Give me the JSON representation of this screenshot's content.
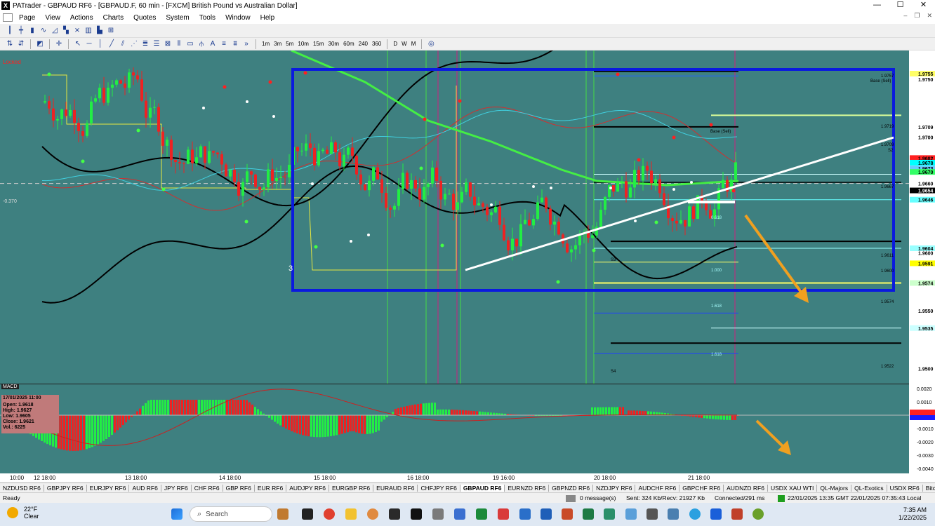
{
  "window": {
    "title": "PATrader - GBPAUD RF6 - [GBPAUD.F, 60 min - [FXCM] British Pound vs Australian Dollar]",
    "app_icon": "X"
  },
  "menu": [
    "Page",
    "View",
    "Actions",
    "Charts",
    "Quotes",
    "System",
    "Tools",
    "Window",
    "Help"
  ],
  "timeframes": [
    "1m",
    "3m",
    "5m",
    "10m",
    "15m",
    "30m",
    "60m",
    "240",
    "360",
    "D",
    "W",
    "M"
  ],
  "chart": {
    "locked_label": "Locked",
    "neg_label": "-0.370",
    "index_label": "INDEX",
    "box_label": "3",
    "price_axis": [
      {
        "price": "1.9755",
        "bg": "#ffff66"
      },
      {
        "price": "1.9750",
        "bg": null
      },
      {
        "price": "1.9709",
        "bg": "#ffffff"
      },
      {
        "price": "1.9700",
        "bg": null
      },
      {
        "price": "1.9682",
        "bg": "#ff2020"
      },
      {
        "price": "1.9678",
        "bg": "#00ffff"
      },
      {
        "price": "1.9673",
        "bg": "#66ccff"
      },
      {
        "price": "1.9670",
        "bg": "#33ff66"
      },
      {
        "price": "1.9660",
        "bg": "#ffffff"
      },
      {
        "price": "1.9654",
        "bg": "#000000"
      },
      {
        "price": "1.9646",
        "bg": "#66ffff"
      },
      {
        "price": "1.9604",
        "bg": "#99ffff"
      },
      {
        "price": "1.9600",
        "bg": null
      },
      {
        "price": "1.9591",
        "bg": "#ffff00"
      },
      {
        "price": "1.9574",
        "bg": "#ccffcc"
      },
      {
        "price": "1.9550",
        "bg": null
      },
      {
        "price": "1.9535",
        "bg": "#ccffff"
      },
      {
        "price": "1.9500",
        "bg": null
      }
    ],
    "level_labels": [
      "1.9757",
      "Base (Sell)",
      "1.9719",
      "Base (Sell)",
      "1.9709",
      "1.9667",
      "1.9611",
      "1.9600",
      "1.9574",
      "1.9522",
      "0.618",
      "1.000",
      "1.618",
      "1.618",
      "S4",
      "S3",
      "S2"
    ],
    "macd_axis": [
      "0.0020",
      "0.0010",
      "0.0000",
      "-0.0010",
      "-0.0020",
      "-0.0030",
      "-0.0040"
    ],
    "macd_label": "MACD",
    "time_axis": [
      "10:00",
      "12 18:00",
      "13 18:00",
      "14 18:00",
      "15 18:00",
      "16 18:00",
      "19 16:00",
      "20 18:00",
      "21 18:00"
    ]
  },
  "info_box": {
    "date": "17/01/2025 11:00",
    "open": "Open: 1.9618",
    "high": "High: 1.9627",
    "low": "Low: 1.9605",
    "close": "Close: 1.9621",
    "vol": "Vol.: 6225"
  },
  "tabs": [
    "NZDUSD RF6",
    "GBPJPY RF6",
    "EURJPY RF6",
    "AUD RF6",
    "JPY RF6",
    "CHF RF6",
    "GBP RF6",
    "EUR RF6",
    "AUDJPY RF6",
    "EURGBP RF6",
    "EURAUD RF6",
    "CHFJPY RF6",
    "GBPAUD RF6",
    "EURNZD RF6",
    "GBPNZD RF6",
    "NZDJPY RF6",
    "AUDCHF RF6",
    "GBPCHF RF6",
    "AUDNZD RF6",
    "USDX XAU WTI",
    "QL-Majors",
    "QL-Exotics",
    "USDX RF6",
    "Bitcoin",
    "SP500 RF6",
    "DJIA"
  ],
  "active_tab": "GBPAUD RF6",
  "status": {
    "ready": "Ready",
    "messages": "0 message(s)",
    "sent": "Sent: 324 Kb/Recv: 21927 Kb",
    "connected": "Connected/291 ms",
    "time": "22/01/2025 13:35 GMT  22/01/2025 07:35:43 Local"
  },
  "taskbar": {
    "temp": "22°F",
    "weather": "Clear",
    "search": "Search",
    "time": "7:35 AM",
    "date": "1/22/2025"
  }
}
